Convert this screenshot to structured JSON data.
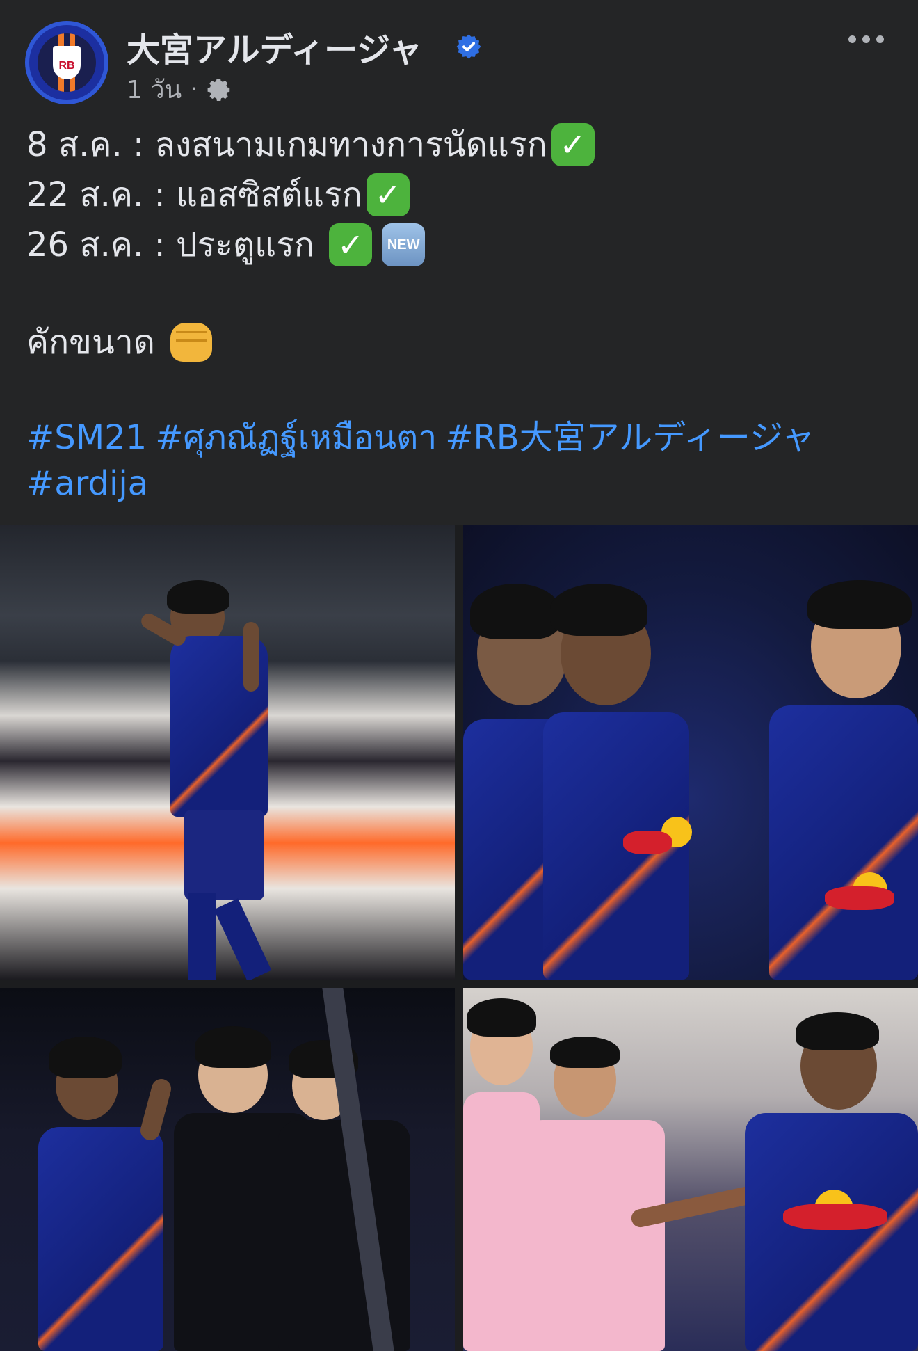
{
  "post": {
    "page_name": "大宮アルディージャ",
    "time": "1 วัน",
    "separator": "·",
    "lines": [
      {
        "text": "8 ส.ค. : ลงสนามเกมทางการนัดแรก"
      },
      {
        "text": "22 ส.ค. : แอสซิสต์แรก"
      },
      {
        "text": "26 ส.ค. : ประตูแรก "
      },
      {
        "text": "คักขนาด"
      }
    ],
    "check_emoji": "✓",
    "new_label": "NEW",
    "hashtags": [
      "#SM21",
      "#ศุภณัฏฐ์เหมือนตา",
      "#RB大宮アルディージャ",
      "#ardija"
    ]
  },
  "avatar_text": "RB",
  "icons": {
    "verified": "verified-badge-icon",
    "audience": "gear-icon",
    "more": "more-options-icon"
  },
  "colors": {
    "background": "#242526",
    "text": "#e4e6eb",
    "meta": "#b0b3b8",
    "hashtag": "#4599ff",
    "verified": "#2f6fe4",
    "jersey": "#1d2f9e",
    "accent_orange": "#e8612a"
  }
}
